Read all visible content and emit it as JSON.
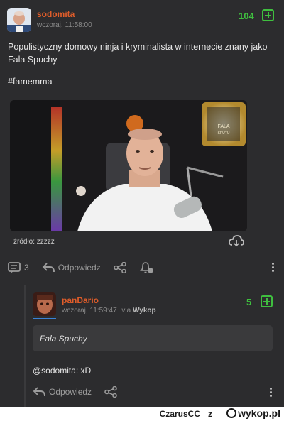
{
  "post": {
    "username": "sodomita",
    "timestamp": "wczoraj, 11:58:00",
    "votes": "104",
    "body_line1": "Populistyczny domowy ninja i kryminalista w internecie znany jako",
    "body_line2": "Fala Spuchy",
    "tag": "#famemma",
    "media_sign": {
      "line1": "FALA",
      "line2": "SPUTU"
    },
    "source": "źródło: zzzzz",
    "comment_count": "3",
    "reply_label": "Odpowiedz"
  },
  "comment": {
    "username": "panDario",
    "timestamp": "wczoraj, 11:59:47",
    "via_prefix": "via",
    "via_app": "Wykop",
    "votes": "5",
    "quote": "Fala Spuchy",
    "text": "@sodomita: xD",
    "reply_label": "Odpowiedz"
  },
  "footer": {
    "user": "CzarusCC",
    "z": "z",
    "site": "wykop.pl"
  },
  "colors": {
    "background": "#2c2c2e",
    "username": "#e05d2a",
    "vote": "#3fbf3f",
    "accent": "#3b82d6"
  }
}
